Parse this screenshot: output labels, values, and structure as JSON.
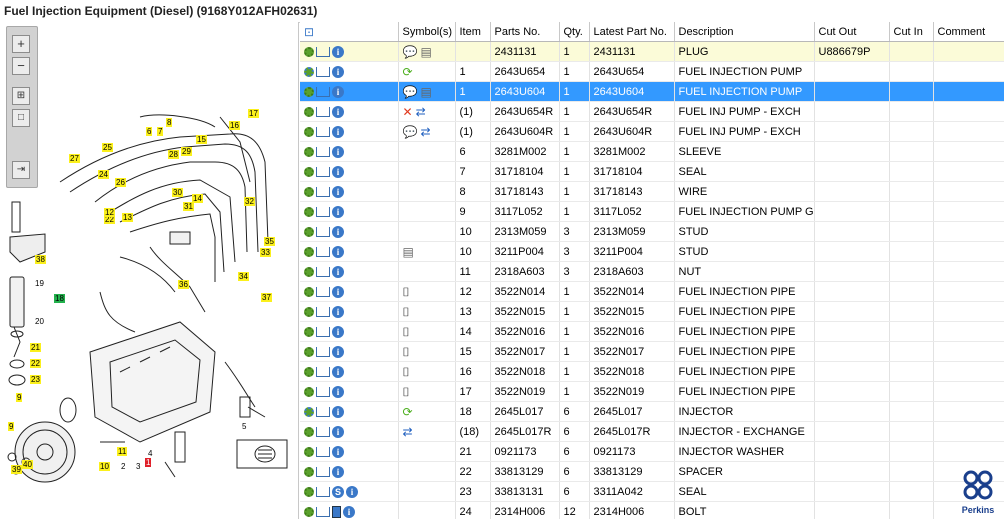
{
  "window": {
    "title": "Fuel Injection Equipment (Diesel) (9168Y012AFH02631)"
  },
  "toolbox": {
    "zoom_in": "+",
    "zoom_out": "−",
    "fit": "⊞",
    "reset": "□",
    "export": "⇥"
  },
  "diagram": {
    "callouts": [
      {
        "label": "17",
        "style": "y"
      },
      {
        "label": "16",
        "style": "y"
      },
      {
        "label": "8",
        "style": "y"
      },
      {
        "label": "6",
        "style": "y"
      },
      {
        "label": "7",
        "style": "y"
      },
      {
        "label": "15",
        "style": "y"
      },
      {
        "label": "27",
        "style": "y"
      },
      {
        "label": "25",
        "style": "y"
      },
      {
        "label": "28",
        "style": "y"
      },
      {
        "label": "29",
        "style": "y"
      },
      {
        "label": "24",
        "style": "y"
      },
      {
        "label": "26",
        "style": "y"
      },
      {
        "label": "22",
        "style": "y"
      },
      {
        "label": "13",
        "style": "y"
      },
      {
        "label": "12",
        "style": "y"
      },
      {
        "label": "14",
        "style": "y"
      },
      {
        "label": "30",
        "style": "y"
      },
      {
        "label": "31",
        "style": "y"
      },
      {
        "label": "32",
        "style": "y"
      },
      {
        "label": "35",
        "style": "y"
      },
      {
        "label": "33",
        "style": "y"
      },
      {
        "label": "34",
        "style": "y"
      },
      {
        "label": "36",
        "style": "y"
      },
      {
        "label": "37",
        "style": "y"
      },
      {
        "label": "38",
        "style": "y"
      },
      {
        "label": "19",
        "style": "w"
      },
      {
        "label": "18",
        "style": "g"
      },
      {
        "label": "20",
        "style": "w"
      },
      {
        "label": "21",
        "style": "y"
      },
      {
        "label": "22",
        "style": "y"
      },
      {
        "label": "23",
        "style": "y"
      },
      {
        "label": "9",
        "style": "y"
      },
      {
        "label": "10",
        "style": "y"
      },
      {
        "label": "11",
        "style": "y"
      },
      {
        "label": "2",
        "style": "w"
      },
      {
        "label": "3",
        "style": "w"
      },
      {
        "label": "4",
        "style": "w"
      },
      {
        "label": "1",
        "style": "r"
      },
      {
        "label": "5",
        "style": "w"
      },
      {
        "label": "39",
        "style": "y"
      },
      {
        "label": "40",
        "style": "y"
      },
      {
        "label": "9",
        "style": "y"
      }
    ]
  },
  "table": {
    "headers": {
      "tools": "",
      "symbols": "Symbol(s)",
      "item": "Item",
      "parts_no": "Parts No.",
      "qty": "Qty.",
      "latest": "Latest Part No.",
      "desc": "Description",
      "cut_out": "Cut Out",
      "cut_in": "Cut In",
      "comment": "Comment"
    },
    "rows": [
      {
        "item": "",
        "parts_no": "2431131",
        "qty": "1",
        "latest": "2431131",
        "desc": "PLUG",
        "cut_out": "U886679P",
        "symbols": "note,book",
        "state": "hl",
        "tools": "gear,cart,info"
      },
      {
        "item": "1",
        "parts_no": "2643U654",
        "qty": "1",
        "latest": "2643U654",
        "desc": "FUEL INJECTION PUMP",
        "cut_out": "",
        "symbols": "recycle",
        "state": "",
        "tools": "gears,cart,info"
      },
      {
        "item": "1",
        "parts_no": "2643U604",
        "qty": "1",
        "latest": "2643U604",
        "desc": "FUEL INJECTION PUMP",
        "cut_out": "",
        "symbols": "note,book",
        "state": "sel",
        "tools": "gear,cart,info"
      },
      {
        "item": "(1)",
        "parts_no": "2643U654R",
        "qty": "1",
        "latest": "2643U654R",
        "desc": "FUEL INJ PUMP - EXCH",
        "cut_out": "",
        "symbols": "cross,exchange",
        "state": "",
        "tools": "gear,cart,info"
      },
      {
        "item": "(1)",
        "parts_no": "2643U604R",
        "qty": "1",
        "latest": "2643U604R",
        "desc": "FUEL INJ PUMP - EXCH",
        "cut_out": "",
        "symbols": "note,exchange",
        "state": "",
        "tools": "gear,cart,info"
      },
      {
        "item": "6",
        "parts_no": "3281M002",
        "qty": "1",
        "latest": "3281M002",
        "desc": "SLEEVE",
        "cut_out": "",
        "symbols": "",
        "state": "",
        "tools": "gear,cart,info"
      },
      {
        "item": "7",
        "parts_no": "31718104",
        "qty": "1",
        "latest": "31718104",
        "desc": "SEAL",
        "cut_out": "",
        "symbols": "",
        "state": "",
        "tools": "gear,cart,info"
      },
      {
        "item": "8",
        "parts_no": "31718143",
        "qty": "1",
        "latest": "31718143",
        "desc": "WIRE",
        "cut_out": "",
        "symbols": "",
        "state": "",
        "tools": "gear,cart,info"
      },
      {
        "item": "9",
        "parts_no": "3117L052",
        "qty": "1",
        "latest": "3117L052",
        "desc": "FUEL INJECTION PUMP GEA",
        "cut_out": "",
        "symbols": "",
        "state": "",
        "tools": "gear,cart,info"
      },
      {
        "item": "10",
        "parts_no": "2313M059",
        "qty": "3",
        "latest": "2313M059",
        "desc": "STUD",
        "cut_out": "",
        "symbols": "",
        "state": "",
        "tools": "gear,cart,info"
      },
      {
        "item": "10",
        "parts_no": "3211P004",
        "qty": "3",
        "latest": "3211P004",
        "desc": "STUD",
        "cut_out": "",
        "symbols": "book",
        "state": "",
        "tools": "gear,cart,info"
      },
      {
        "item": "11",
        "parts_no": "2318A603",
        "qty": "3",
        "latest": "2318A603",
        "desc": "NUT",
        "cut_out": "",
        "symbols": "",
        "state": "",
        "tools": "gear,cart,info"
      },
      {
        "item": "12",
        "parts_no": "3522N014",
        "qty": "1",
        "latest": "3522N014",
        "desc": "FUEL INJECTION PIPE",
        "cut_out": "",
        "symbols": "cylinder",
        "state": "",
        "tools": "gear,cart,info"
      },
      {
        "item": "13",
        "parts_no": "3522N015",
        "qty": "1",
        "latest": "3522N015",
        "desc": "FUEL INJECTION PIPE",
        "cut_out": "",
        "symbols": "cylinder",
        "state": "",
        "tools": "gear,cart,info"
      },
      {
        "item": "14",
        "parts_no": "3522N016",
        "qty": "1",
        "latest": "3522N016",
        "desc": "FUEL INJECTION PIPE",
        "cut_out": "",
        "symbols": "cylinder",
        "state": "",
        "tools": "gear,cart,info"
      },
      {
        "item": "15",
        "parts_no": "3522N017",
        "qty": "1",
        "latest": "3522N017",
        "desc": "FUEL INJECTION PIPE",
        "cut_out": "",
        "symbols": "cylinder",
        "state": "",
        "tools": "gear,cart,info"
      },
      {
        "item": "16",
        "parts_no": "3522N018",
        "qty": "1",
        "latest": "3522N018",
        "desc": "FUEL INJECTION PIPE",
        "cut_out": "",
        "symbols": "cylinder",
        "state": "",
        "tools": "gear,cart,info"
      },
      {
        "item": "17",
        "parts_no": "3522N019",
        "qty": "1",
        "latest": "3522N019",
        "desc": "FUEL INJECTION PIPE",
        "cut_out": "",
        "symbols": "cylinder",
        "state": "",
        "tools": "gear,cart,info"
      },
      {
        "item": "18",
        "parts_no": "2645L017",
        "qty": "6",
        "latest": "2645L017",
        "desc": "INJECTOR",
        "cut_out": "",
        "symbols": "recycle",
        "state": "",
        "tools": "gears,cart,info"
      },
      {
        "item": "(18)",
        "parts_no": "2645L017R",
        "qty": "6",
        "latest": "2645L017R",
        "desc": "INJECTOR - EXCHANGE",
        "cut_out": "",
        "symbols": "exchange",
        "state": "",
        "tools": "gear,cart,info"
      },
      {
        "item": "21",
        "parts_no": "0921173",
        "qty": "6",
        "latest": "0921173",
        "desc": "INJECTOR WASHER",
        "cut_out": "",
        "symbols": "",
        "state": "",
        "tools": "gear,cart,info"
      },
      {
        "item": "22",
        "parts_no": "33813129",
        "qty": "6",
        "latest": "33813129",
        "desc": "SPACER",
        "cut_out": "",
        "symbols": "",
        "state": "",
        "tools": "gear,cart,info"
      },
      {
        "item": "23",
        "parts_no": "33813131",
        "qty": "6",
        "latest": "3311A042",
        "desc": "SEAL",
        "cut_out": "",
        "symbols": "",
        "state": "",
        "tools": "gear,cart,s,info"
      },
      {
        "item": "24",
        "parts_no": "2314H006",
        "qty": "12",
        "latest": "2314H006",
        "desc": "BOLT",
        "cut_out": "",
        "symbols": "",
        "state": "",
        "tools": "gear,cart,bookb,info"
      }
    ]
  },
  "brand": {
    "name": "Perkins",
    "color": "#1a3f8c"
  },
  "colors": {
    "selection": "#3399ff",
    "highlight": "#fbfbd8",
    "callout": "#fbf01c"
  }
}
